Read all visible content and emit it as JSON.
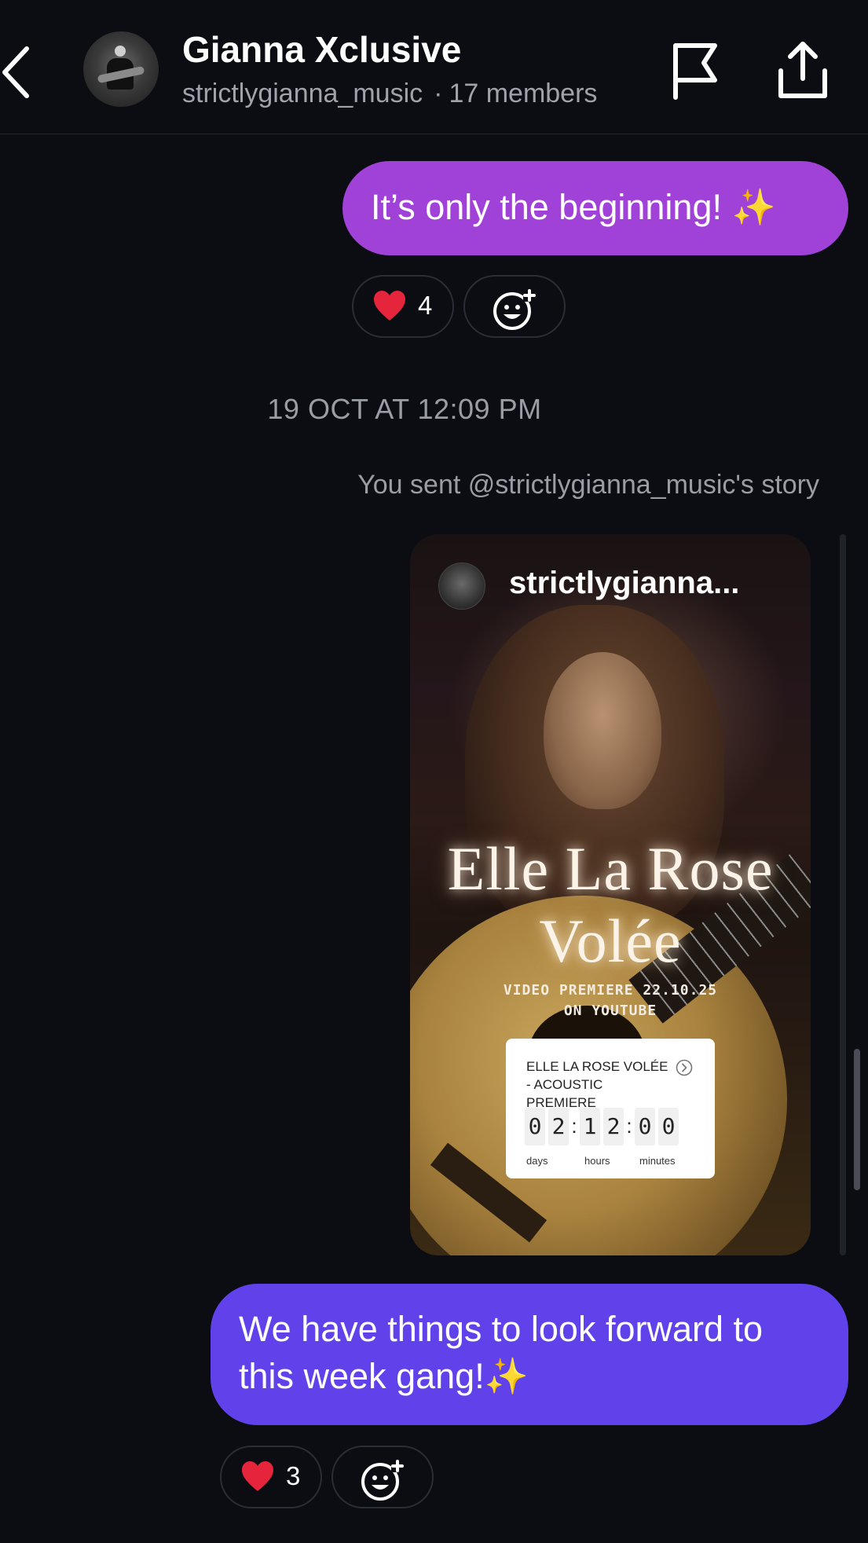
{
  "header": {
    "title": "Gianna Xclusive",
    "username": "strictlygianna_music",
    "separator": "·",
    "members": "17 members"
  },
  "messages": {
    "first": {
      "text": "It’s only the beginning! ✨",
      "reaction_count": "4"
    },
    "timestamp": "19 OCT AT 12:09 PM",
    "sent_note": "You sent @strictlygianna_music's story",
    "story": {
      "username": "strictlygianna...",
      "title_line1": "Elle La Rose",
      "title_line2": "Volée",
      "premiere_line1": "VIDEO PREMIERE 22.10.25",
      "premiere_line2": "ON YOUTUBE",
      "countdown": {
        "title": "ELLE LA ROSE VOLÉE - ACOUSTIC PREMIERE",
        "digits": [
          "0",
          "2",
          "1",
          "2",
          "0",
          "0"
        ],
        "label_days": "days",
        "label_hours": "hours",
        "label_minutes": "minutes"
      }
    },
    "second": {
      "text": "We have things to look forward to this week gang!✨",
      "reaction_count": "3"
    }
  },
  "icons": {
    "back": "chevron-left-icon",
    "flag": "flag-icon",
    "share": "share-icon",
    "heart": "heart-icon",
    "add_reaction": "add-reaction-icon"
  },
  "colors": {
    "background": "#0b0d12",
    "bubble_purple": "#a042d8",
    "bubble_violet": "#6142ea",
    "heart": "#e5253b"
  }
}
